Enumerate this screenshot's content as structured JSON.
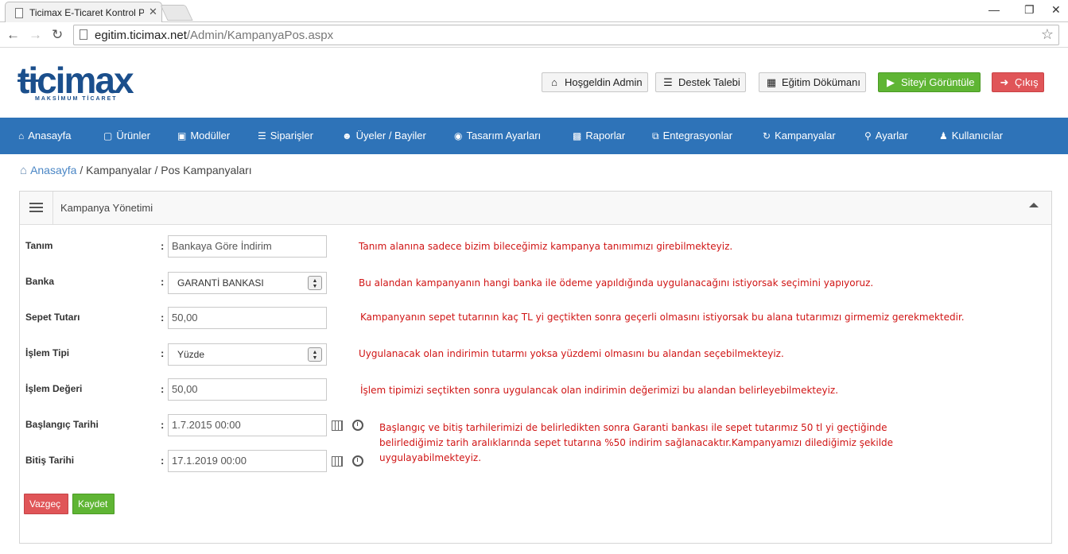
{
  "browser": {
    "tab_title": "Ticimax E-Ticaret Kontrol P",
    "url_host": "egitim.ticimax.net",
    "url_path": "/Admin/KampanyaPos.aspx"
  },
  "logo": {
    "word": "ticimax",
    "tagline": "MAKSİMUM TİCARET"
  },
  "header_buttons": {
    "welcome": "Hoşgeldin Admin",
    "support": "Destek Talebi",
    "docs": "Eğitim Dökümanı",
    "view_site": "Siteyi Görüntüle",
    "logout": "Çıkış"
  },
  "nav": [
    {
      "label": "Anasayfa",
      "icon": "home-icon"
    },
    {
      "label": "Ürünler",
      "icon": "folder-icon"
    },
    {
      "label": "Modüller",
      "icon": "box-icon"
    },
    {
      "label": "Siparişler",
      "icon": "list-icon"
    },
    {
      "label": "Üyeler / Bayiler",
      "icon": "users-icon"
    },
    {
      "label": "Tasarım Ayarları",
      "icon": "palette-icon"
    },
    {
      "label": "Raporlar",
      "icon": "chart-icon"
    },
    {
      "label": "Entegrasyonlar",
      "icon": "copy-icon"
    },
    {
      "label": "Kampanyalar",
      "icon": "refresh-icon"
    },
    {
      "label": "Ayarlar",
      "icon": "key-icon"
    },
    {
      "label": "Kullanıcılar",
      "icon": "user-icon"
    }
  ],
  "breadcrumb": {
    "home": "Anasayfa",
    "sep": "/",
    "section": "Kampanyalar",
    "page": "Pos Kampanyaları"
  },
  "panel": {
    "title": "Kampanya Yönetimi"
  },
  "form": {
    "tanim": {
      "label": "Tanım",
      "value": "Bankaya Göre İndirim"
    },
    "banka": {
      "label": "Banka",
      "value": "GARANTİ BANKASI"
    },
    "sepet": {
      "label": "Sepet Tutarı",
      "value": "50,00"
    },
    "islem_tipi": {
      "label": "İşlem Tipi",
      "value": "Yüzde"
    },
    "islem_degeri": {
      "label": "İşlem Değeri",
      "value": "50,00"
    },
    "baslangic": {
      "label": "Başlangıç Tarihi",
      "value": "1.7.2015 00:00"
    },
    "bitis": {
      "label": "Bitiş Tarihi",
      "value": "17.1.2019 00:00"
    },
    "colon": ":"
  },
  "notes": {
    "tanim": "Tanım alanına sadece bizim bileceğimiz kampanya tanımımızı girebilmekteyiz.",
    "banka": "Bu alandan kampanyanın hangi banka ile ödeme yapıldığında uygulanacağını istiyorsak seçimini yapıyoruz.",
    "sepet": "Kampanyanın sepet tutarının kaç TL yi geçtikten sonra geçerli olmasını istiyorsak bu alana tutarımızı girmemiz gerekmektedir.",
    "islem_tipi": "Uygulanacak olan indirimin tutarmı yoksa yüzdemi olmasını bu alandan seçebilmekteyiz.",
    "islem_degeri": "İşlem tipimizi seçtikten sonra uygulancak olan indirimin değerimizi bu alandan belirleyebilmekteyiz.",
    "tarih_1": "Başlangıç ve bitiş tarhilerimizi de belirledikten sonra Garanti bankası ile sepet tutarımız 50 tl yi geçtiğinde",
    "tarih_2": "belirlediğimiz tarih aralıklarında sepet tutarına %50 indirim sağlanacaktır.Kampanyamızı dilediğimiz şekilde",
    "tarih_3": "uygulayabilmekteyiz."
  },
  "actions": {
    "cancel": "Vazgeç",
    "save": "Kaydet"
  },
  "colors": {
    "nav_bg": "#2e73b8",
    "green": "#5fb534",
    "red": "#e05558",
    "note": "#d01515",
    "brand": "#1b4f8c"
  }
}
